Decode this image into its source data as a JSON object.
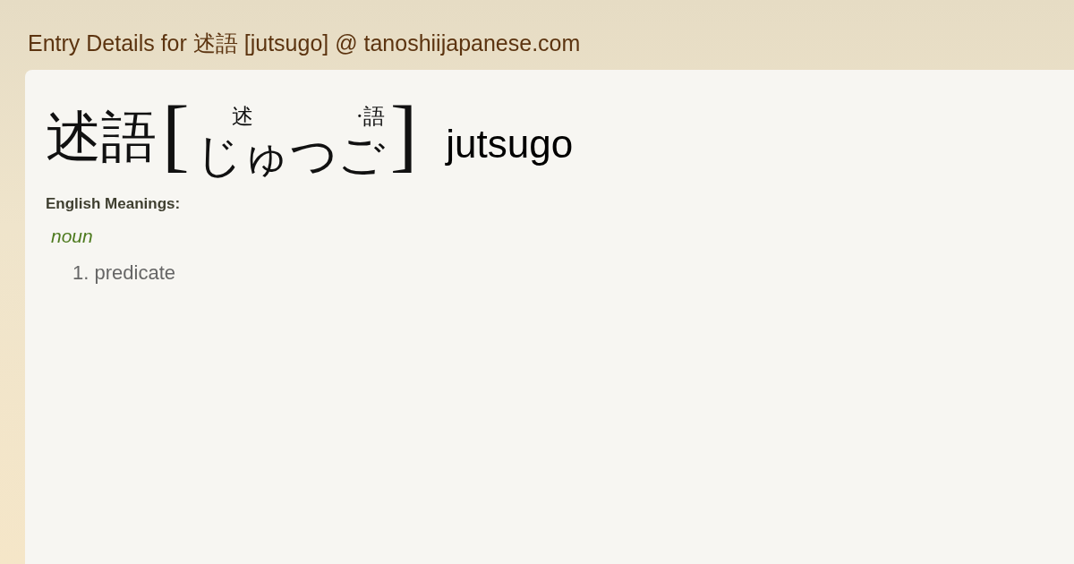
{
  "page_title": "Entry Details for 述語 [jutsugo] @ tanoshiijapanese.com",
  "entry": {
    "kanji": "述語",
    "open_bracket": "[",
    "reading": [
      {
        "kana": "じゅ",
        "ruby": "述"
      },
      {
        "kana": "つご",
        "ruby": "·語"
      }
    ],
    "close_bracket": "]",
    "romaji": "jutsugo"
  },
  "meanings_label": "English Meanings:",
  "part_of_speech": "noun",
  "meanings": [
    {
      "number": "1.",
      "text": "predicate"
    }
  ]
}
